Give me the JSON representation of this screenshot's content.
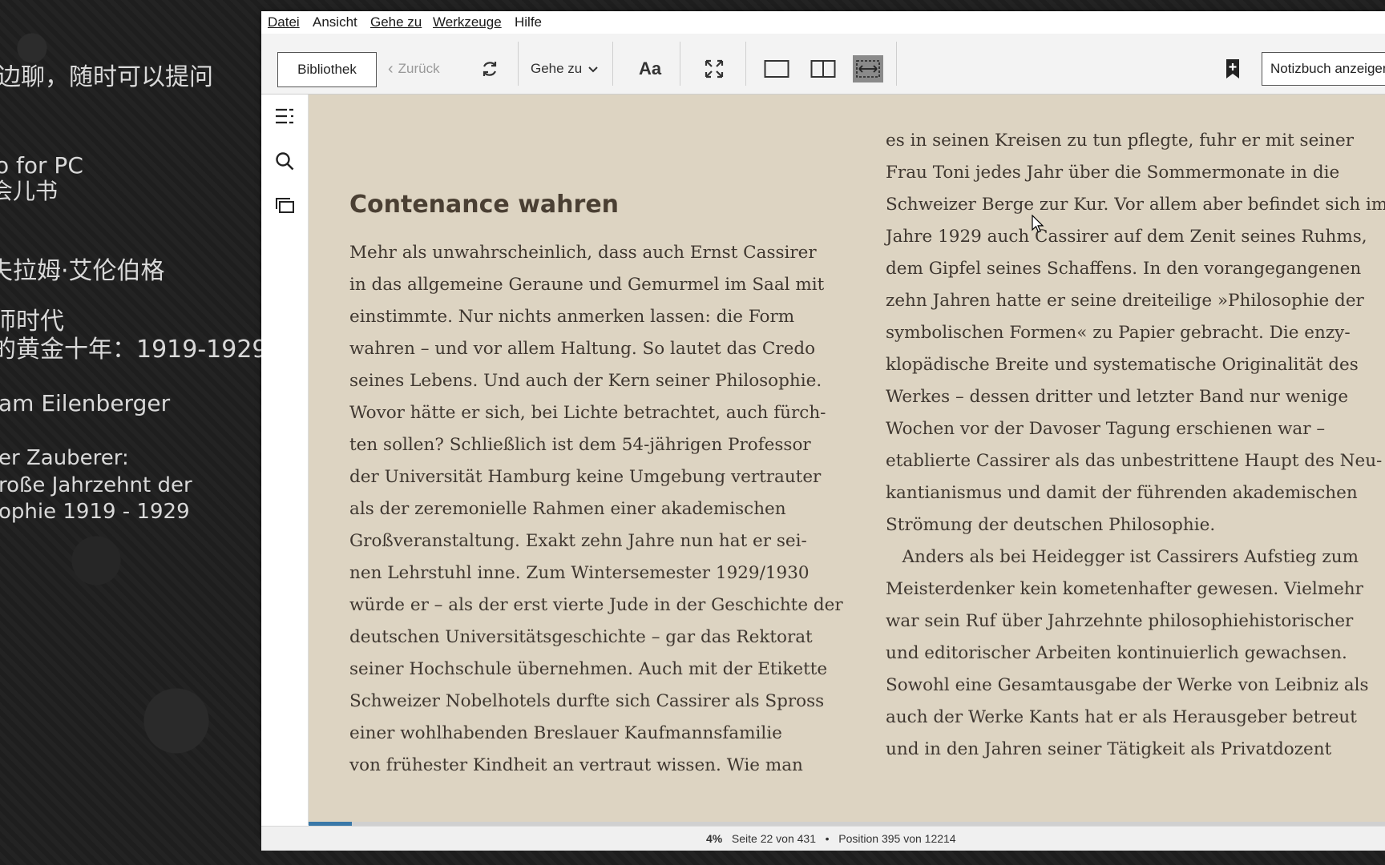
{
  "desktop": {
    "lines": [
      {
        "text": "边聊，随时可以提问"
      },
      {
        "text": "o for PC"
      },
      {
        "text": "会儿书"
      },
      {
        "text": "夫拉姆·艾伦伯格"
      },
      {
        "text": "师时代"
      },
      {
        "text": "的黄金十年：1919-1929"
      },
      {
        "text": "am Eilenberger"
      },
      {
        "text": "er Zauberer:"
      },
      {
        "text": "roße Jahrzehnt der"
      },
      {
        "text": "ophie 1919 - 1929"
      }
    ]
  },
  "menu": {
    "datei": "Datei",
    "ansicht": "Ansicht",
    "gehe_zu": "Gehe zu",
    "werkzeuge": "Werkzeuge",
    "hilfe": "Hilfe"
  },
  "toolbar": {
    "library": "Bibliothek",
    "back": "Zurück",
    "goto": "Gehe zu",
    "font": "Aa",
    "notebook": "Notizbuch anzeigen"
  },
  "book": {
    "chapter_title": "Contenance wahren",
    "left_lines": [
      "Mehr als unwahrscheinlich, dass auch Ernst Cassirer",
      "in das allgemeine Geraune und Gemurmel im Saal mit",
      "einstimmte. Nur nichts anmerken lassen: die Form",
      "wahren – und vor allem Haltung. So lautet das Credo",
      "seines Lebens. Und auch der Kern seiner Philosophie.",
      "Wovor hätte er sich, bei Lichte betrachtet, auch fürch-",
      "ten sollen? Schließlich ist dem 54-jährigen Professor",
      "der Universität Hamburg keine Umgebung vertrauter",
      "als der zeremonielle Rahmen einer akademischen",
      "Großveranstaltung. Exakt zehn Jahre nun hat er sei-",
      "nen Lehrstuhl inne. Zum Wintersemester 1929/1930",
      "würde er – als der erst vierte Jude in der Geschichte der",
      "deutschen Universitätsgeschichte – gar das Rektorat",
      "seiner Hochschule übernehmen. Auch mit der Etikette",
      "Schweizer Nobelhotels durfte sich Cassirer als Spross",
      "einer wohlhabenden Breslauer Kaufmannsfamilie",
      "von frühester Kindheit an vertraut wissen. Wie man"
    ],
    "right_lines": [
      "es in seinen Kreisen zu tun pflegte, fuhr er mit seiner",
      "Frau Toni jedes Jahr über die Sommermonate in die",
      "Schweizer Berge zur Kur. Vor allem aber befindet sich im",
      "Jahre 1929 auch Cassirer auf dem Zenit seines Ruhms,",
      "dem Gipfel seines Schaffens. In den vorangegangenen",
      "zehn Jahren hatte er seine dreiteilige »Philosophie der",
      "symbolischen Formen« zu Papier gebracht. Die enzy-",
      "klopädische Breite und systematische Originalität des",
      "Werkes – dessen dritter und letzter Band nur wenige",
      "Wochen vor der Davoser Tagung erschienen war –",
      "etablierte Cassirer als das unbestrittene Haupt des Neu-",
      "kantianismus und damit der führenden akademischen",
      "Strömung der deutschen Philosophie.",
      "   Anders als bei Heidegger ist Cassirers Aufstieg zum",
      "Meisterdenker kein kometenhafter gewesen. Vielmehr",
      "war sein Ruf über Jahrzehnte philosophiehistorischer",
      "und editorischer Arbeiten kontinuierlich gewachsen.",
      "Sowohl eine Gesamtausgabe der Werke von Leibniz als",
      "auch der Werke Kants hat er als Herausgeber betreut",
      "und in den Jahren seiner Tätigkeit als Privatdozent"
    ]
  },
  "status": {
    "percent": "4%",
    "page": "Seite 22 von 431",
    "separator": "•",
    "position": "Position 395 von 12214",
    "progress_fraction": 0.04
  },
  "colors": {
    "reader_bg": "#ddd4c2",
    "progress": "#3a78a8"
  }
}
